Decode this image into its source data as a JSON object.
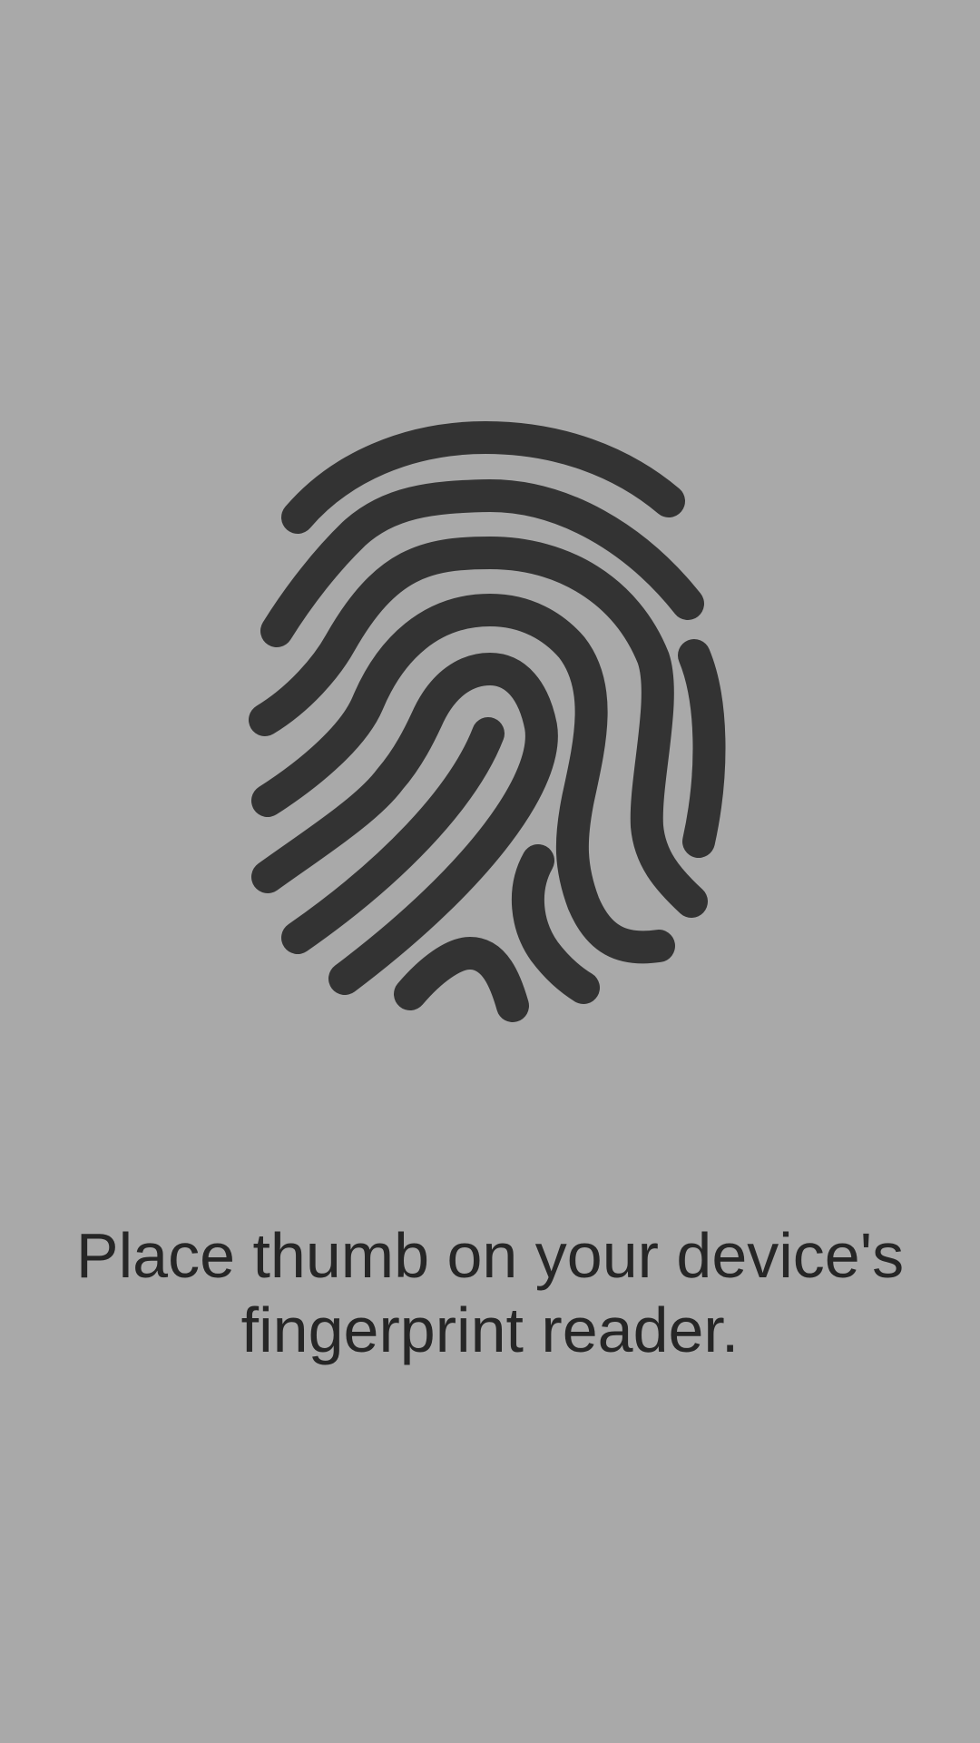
{
  "prompt": {
    "text": "Place thumb on your device's fingerprint reader."
  },
  "icon": {
    "name": "fingerprint-icon",
    "color": "#333333"
  },
  "colors": {
    "background": "#a9a9a9",
    "text": "#262626"
  }
}
